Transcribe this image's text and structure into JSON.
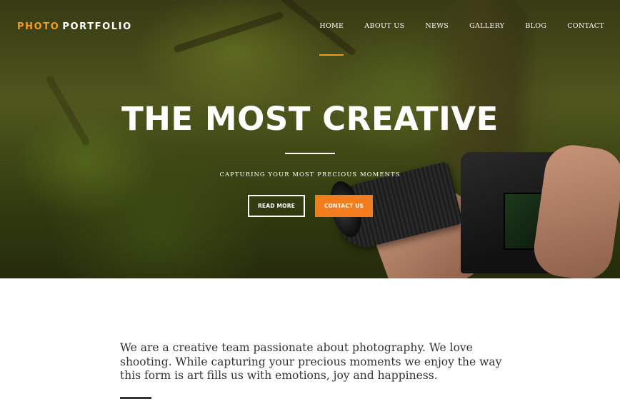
{
  "brand": {
    "part1": "PHOTO",
    "part2": "PORTFOLIO",
    "accent_color": "#f39c1f"
  },
  "nav": {
    "items": [
      {
        "label": "HOME",
        "active": true
      },
      {
        "label": "ABOUT US",
        "active": false
      },
      {
        "label": "NEWS",
        "active": false
      },
      {
        "label": "GALLERY",
        "active": false
      },
      {
        "label": "BLOG",
        "active": false
      },
      {
        "label": "CONTACT",
        "active": false
      }
    ]
  },
  "hero": {
    "title": "THE MOST CREATIVE",
    "subtitle": "CAPTURING YOUR MOST PRECIOUS MOMENTS",
    "primary_button": "READ MORE",
    "secondary_button": "CONTACT US",
    "secondary_button_color": "#f37c1f"
  },
  "about": {
    "text": "We are a creative team passionate about photography. We love shooting. While capturing your precious moments we enjoy the way this form is art fills us with emotions, joy and happiness."
  }
}
